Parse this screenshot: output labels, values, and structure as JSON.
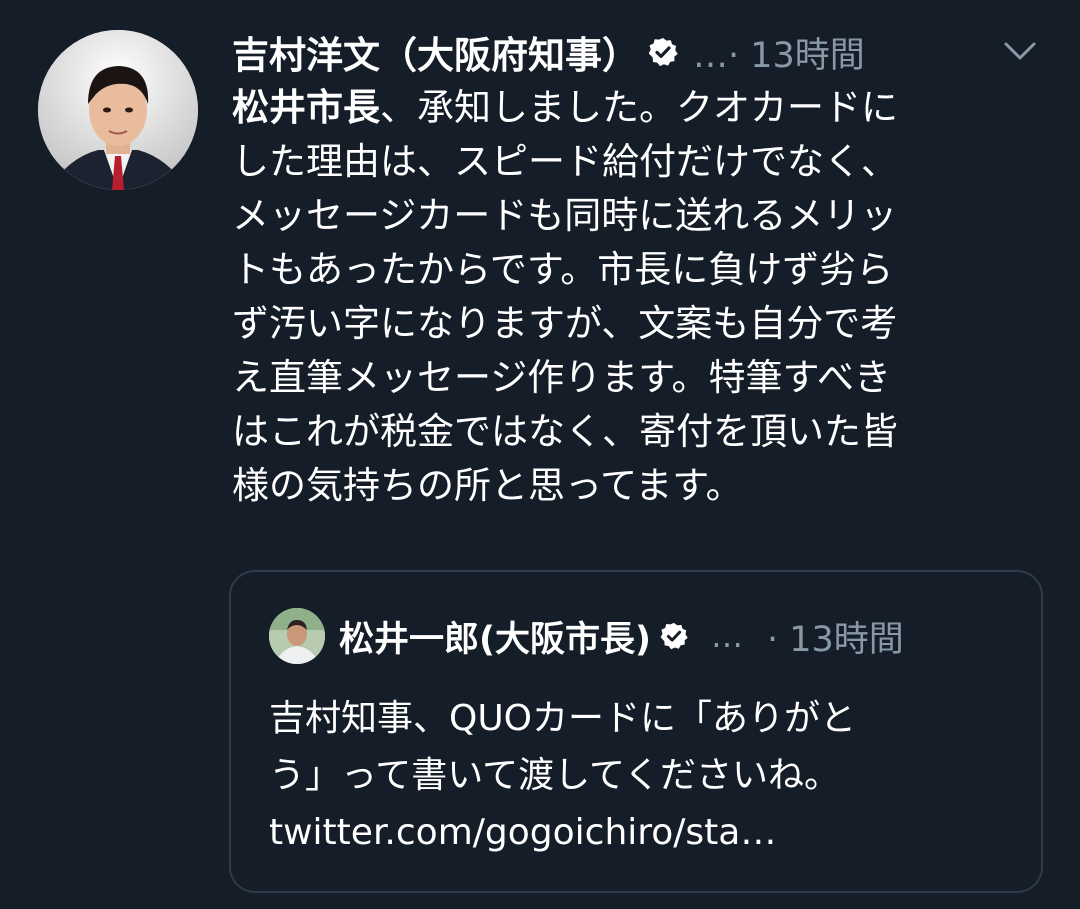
{
  "tweet": {
    "author_name": "吉村洋文（大阪府知事）",
    "meta": "…· 13時間",
    "body_line1_mention": "松井市長",
    "body_line1_rest": "、承知しました。クオカードに",
    "body_lines": [
      "した理由は、スピード給付だけでなく、",
      "メッセージカードも同時に送れるメリッ",
      "トもあったからです。市長に負けず劣ら",
      "ず汚い字になりますが、文案も自分で考",
      "え直筆メッセージ作ります。特筆すべき",
      "はこれが税金ではなく、寄付を頂いた皆",
      "様の気持ちの所と思ってます。"
    ]
  },
  "quoted_tweet": {
    "author_name": "松井一郎(大阪市長)",
    "dots": "…",
    "time": "· 13時間",
    "text_lines": [
      "吉村知事、QUOカードに「ありがと",
      "う」って書いて渡してくださいね。",
      "twitter.com/gogoichiro/sta…"
    ]
  },
  "icons": {
    "verified": "verified-badge-icon",
    "chevron": "chevron-down-icon"
  },
  "colors": {
    "background": "#151d28",
    "text": "#ffffff",
    "muted": "#8899a6",
    "border": "#2f3b48"
  }
}
